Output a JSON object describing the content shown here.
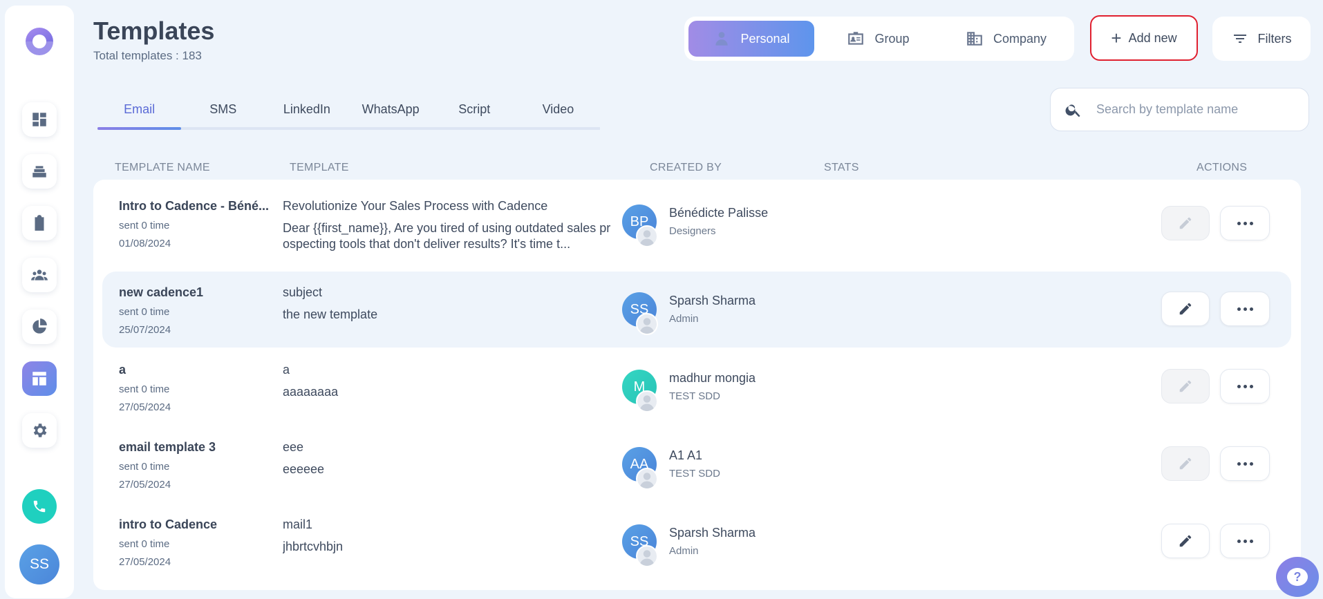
{
  "page": {
    "title": "Templates",
    "total_label": "Total templates : 183"
  },
  "scope": {
    "options": [
      {
        "label": "Personal",
        "icon": "person-icon",
        "active": true
      },
      {
        "label": "Group",
        "icon": "id-card-icon",
        "active": false
      },
      {
        "label": "Company",
        "icon": "building-icon",
        "active": false
      }
    ]
  },
  "toolbar": {
    "add_label": "Add new",
    "filters_label": "Filters"
  },
  "tabs": [
    {
      "label": "Email",
      "active": true
    },
    {
      "label": "SMS",
      "active": false
    },
    {
      "label": "LinkedIn",
      "active": false
    },
    {
      "label": "WhatsApp",
      "active": false
    },
    {
      "label": "Script",
      "active": false
    },
    {
      "label": "Video",
      "active": false
    }
  ],
  "search": {
    "placeholder": "Search by template name",
    "value": ""
  },
  "columns": {
    "name": "TEMPLATE NAME",
    "template": "TEMPLATE",
    "created_by": "CREATED BY",
    "stats": "STATS",
    "actions": "ACTIONS"
  },
  "rows": [
    {
      "name": "Intro to Cadence - Béné...",
      "sent": "sent 0 time",
      "date": "01/08/2024",
      "subject": "Revolutionize Your Sales Process with Cadence",
      "body": "Dear {{first_name}},   Are you tired of using outdated sales prospecting tools that don't deliver results? It's time t...",
      "initials": "BP",
      "creator": "Bénédicte Palisse",
      "role": "Designers",
      "edit_enabled": false
    },
    {
      "name": "new cadence1",
      "sent": "sent 0 time",
      "date": "25/07/2024",
      "subject": "subject",
      "body": "the new template",
      "initials": "SS",
      "creator": "Sparsh Sharma",
      "role": "Admin",
      "edit_enabled": true
    },
    {
      "name": "a",
      "sent": "sent 0 time",
      "date": "27/05/2024",
      "subject": "a",
      "body": "aaaaaaaa",
      "initials": "M",
      "creator": "madhur mongia",
      "role": "TEST SDD",
      "edit_enabled": false
    },
    {
      "name": "email template 3",
      "sent": "sent 0 time",
      "date": "27/05/2024",
      "subject": "eee",
      "body": "eeeeee",
      "initials": "AA",
      "creator": "A1 A1",
      "role": "TEST SDD",
      "edit_enabled": false
    },
    {
      "name": "intro to Cadence",
      "sent": "sent 0 time",
      "date": "27/05/2024",
      "subject": "mail1",
      "body": "jhbrtcvhbjn",
      "initials": "SS",
      "creator": "Sparsh Sharma",
      "role": "Admin",
      "edit_enabled": true
    }
  ],
  "user": {
    "initials": "SS"
  },
  "colors": {
    "accent": "#5a6ad6",
    "add_border": "#e0202f",
    "call": "#1fd0bf"
  }
}
